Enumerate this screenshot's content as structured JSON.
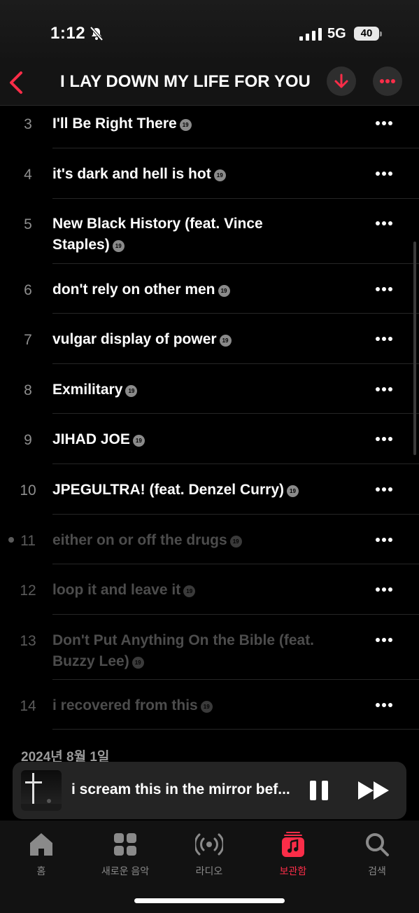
{
  "status_bar": {
    "time": "1:12",
    "network": "5G",
    "battery": "40"
  },
  "header": {
    "title": "I LAY DOWN MY LIFE FOR YOU"
  },
  "tracks": [
    {
      "number": "3",
      "title": "I'll Be Right There",
      "badge": "19"
    },
    {
      "number": "4",
      "title": "it's dark and hell is hot",
      "badge": "19"
    },
    {
      "number": "5",
      "title_line1": "New Black History (feat. Vince",
      "title_line2": "Staples)",
      "badge": "19"
    },
    {
      "number": "6",
      "title": "don't rely on other men",
      "badge": "19"
    },
    {
      "number": "7",
      "title": "vulgar display of power",
      "badge": "19"
    },
    {
      "number": "8",
      "title": "Exmilitary",
      "badge": "19"
    },
    {
      "number": "9",
      "title": "JIHAD JOE",
      "badge": "19"
    },
    {
      "number": "10",
      "title": "JPEGULTRA! (feat. Denzel Curry)",
      "badge": "19"
    },
    {
      "number": "11",
      "title": "either on or off the drugs",
      "badge": "19"
    },
    {
      "number": "12",
      "title": "loop it and leave it",
      "badge": "19"
    },
    {
      "number": "13",
      "title_line1": "Don't Put Anything On the Bible (feat.",
      "title_line2": "Buzzy Lee)",
      "badge": "19"
    },
    {
      "number": "14",
      "title": "i recovered from this",
      "badge": "19"
    }
  ],
  "section_date": "2024년 8월 1일",
  "mini_player": {
    "title": "i scream this in the mirror bef..."
  },
  "tabs": [
    {
      "label": "홈",
      "icon": "house-icon"
    },
    {
      "label": "새로운 음악",
      "icon": "grid-icon"
    },
    {
      "label": "라디오",
      "icon": "radio-icon"
    },
    {
      "label": "보관함",
      "icon": "library-icon",
      "active": true
    },
    {
      "label": "검색",
      "icon": "search-icon"
    }
  ],
  "colors": {
    "accent": "#fa2d48",
    "background": "#000000",
    "dimmed_text": "#4c4c4c"
  }
}
